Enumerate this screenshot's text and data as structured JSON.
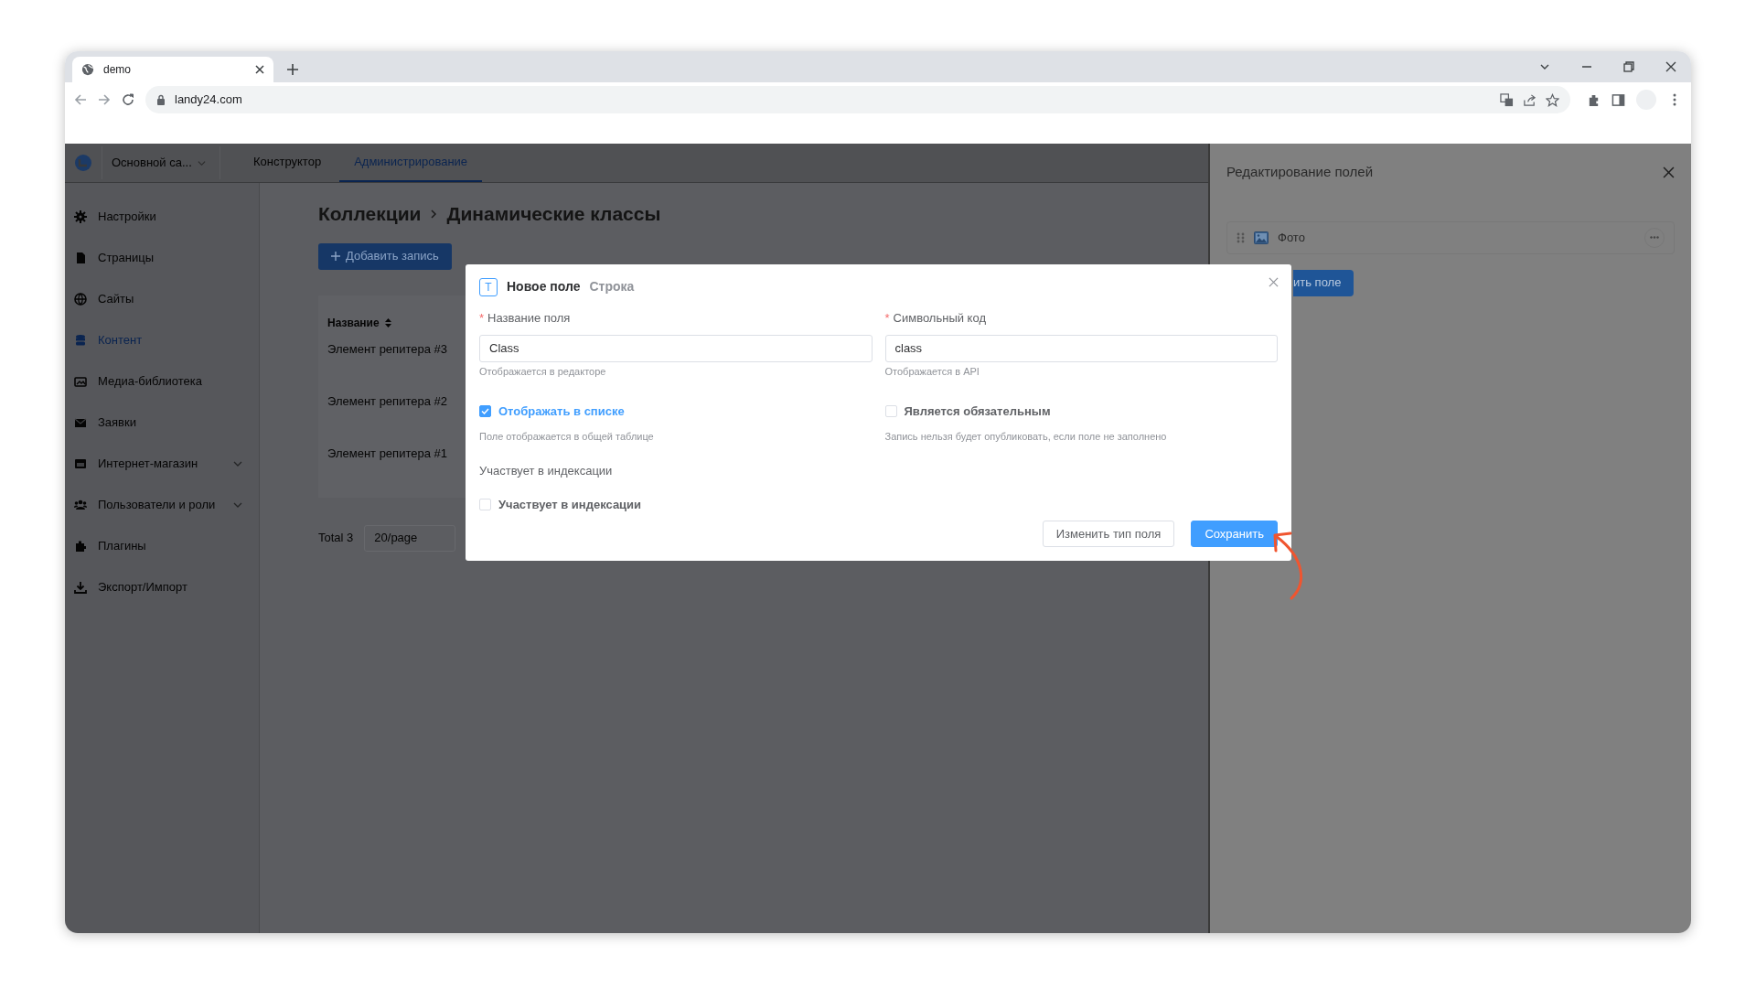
{
  "browser": {
    "tab_title": "demo",
    "url": "landy24.com"
  },
  "header": {
    "site_selector": "Основной са...",
    "tabs": [
      {
        "label": "Конструктор",
        "selected": false
      },
      {
        "label": "Администрирование",
        "selected": true
      }
    ]
  },
  "sidebar": {
    "items": [
      {
        "label": "Настройки",
        "selected": false,
        "expandable": false
      },
      {
        "label": "Страницы",
        "selected": false,
        "expandable": false
      },
      {
        "label": "Сайты",
        "selected": false,
        "expandable": false
      },
      {
        "label": "Контент",
        "selected": true,
        "expandable": false
      },
      {
        "label": "Медиа-библиотека",
        "selected": false,
        "expandable": false
      },
      {
        "label": "Заявки",
        "selected": false,
        "expandable": false
      },
      {
        "label": "Интернет-магазин",
        "selected": false,
        "expandable": true
      },
      {
        "label": "Пользователи и роли",
        "selected": false,
        "expandable": true
      },
      {
        "label": "Плагины",
        "selected": false,
        "expandable": false
      },
      {
        "label": "Экспорт/Импорт",
        "selected": false,
        "expandable": false
      }
    ]
  },
  "main": {
    "breadcrumb": [
      "Коллекции",
      "Динамические классы"
    ],
    "add_button": "Добавить запись",
    "table": {
      "columns": [
        "Название"
      ],
      "rows": [
        "Элемент репитера #3",
        "Элемент репитера #2",
        "Элемент репитера #1"
      ]
    },
    "pagination": {
      "total": "Total 3",
      "page_size": "20/page"
    }
  },
  "right_panel": {
    "title": "Редактирование полей",
    "fields": [
      {
        "label": "Фото"
      }
    ],
    "add_button": "ить поле"
  },
  "modal": {
    "type_icon": "T",
    "title": "Новое поле",
    "subtitle": "Строка",
    "fields": [
      {
        "label": "Название поля",
        "required_mark": "*",
        "value": "Class",
        "help": "Отображается в редакторе"
      },
      {
        "label": "Символьный код",
        "required_mark": "*",
        "value": "class",
        "help": "Отображается в API"
      }
    ],
    "checkboxes": [
      {
        "label": "Отображать в списке",
        "checked": true,
        "help": "Поле отображается в общей таблице"
      },
      {
        "label": "Является обязательным",
        "checked": false,
        "help": "Запись нельзя будет опубликовать, если поле не заполнено"
      }
    ],
    "indexing": {
      "label": "Участвует в индексации",
      "checkbox": {
        "label": "Участвует в индексации",
        "checked": false
      }
    },
    "buttons": [
      {
        "label": "Изменить тип поля",
        "kind": "default"
      },
      {
        "label": "Сохранить",
        "kind": "primary"
      }
    ]
  }
}
